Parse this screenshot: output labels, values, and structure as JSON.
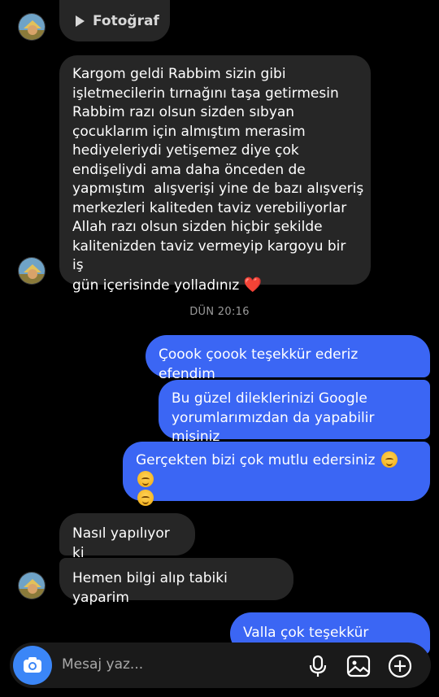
{
  "thread": {
    "photo_label": "Fotoğraf",
    "timestamp": "DÜN 20:16",
    "messages": [
      {
        "direction": "incoming",
        "lines": [
          "Kargom geldi Rabbim sizin gibi",
          "işletmecilerin tırnağını taşa getirmesin",
          "Rabbim razı olsun sizden sıbyan",
          "çocuklarım için almıştım merasim",
          "hediyeleriydi yetişemez diye çok",
          "endişeliydi ama daha önceden de",
          "yapmıştım  alışverişi yine de bazı alışveriş",
          "merkezleri kaliteden taviz verebiliyorlar",
          "Allah razı olsun sizden hiçbir şekilde",
          "kalitenizden taviz vermeyip kargoyu bir iş",
          "gün içerisinde yolladınız"
        ],
        "emoji": "❤️"
      },
      {
        "direction": "outgoing",
        "text": "Çoook çoook teşekkür ederiz efendim"
      },
      {
        "direction": "outgoing",
        "lines": [
          "Bu güzel dileklerinizi Google",
          "yorumlarımızdan da yapabilir misiniz"
        ]
      },
      {
        "direction": "outgoing",
        "text": "Gerçekten bizi çok mutlu edersiniz",
        "emoji": "☺️"
      },
      {
        "direction": "incoming",
        "text": "Nasıl yapılıyor ki"
      },
      {
        "direction": "incoming",
        "text": "Hemen bilgi alıp tabiki yaparim"
      },
      {
        "direction": "outgoing",
        "text": "Valla çok teşekkür ederim"
      }
    ]
  },
  "composer": {
    "placeholder": "Mesaj yaz...",
    "icons": [
      "camera-icon",
      "microphone-icon",
      "gallery-icon",
      "plus-circle-icon"
    ]
  },
  "colors": {
    "background": "#000000",
    "incoming_bubble": "#262626",
    "outgoing_bubble": "#3b66f4",
    "camera_button": "#3b86f7",
    "heart": "#ff2d3a"
  }
}
